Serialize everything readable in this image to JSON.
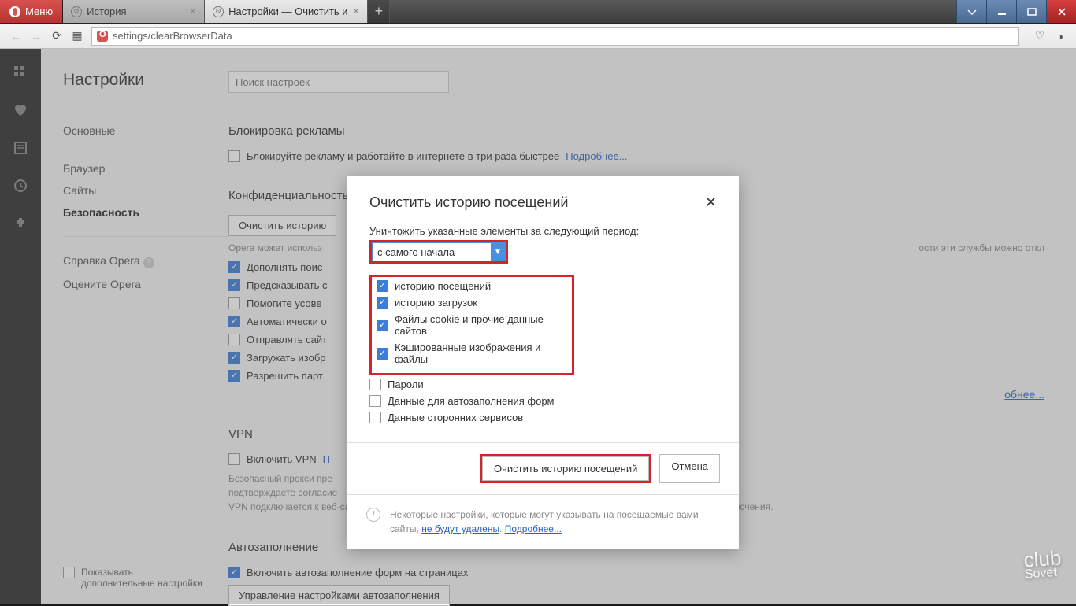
{
  "titlebar": {
    "menu": "Меню",
    "tabs": [
      {
        "label": "История",
        "active": false
      },
      {
        "label": "Настройки — Очистить и",
        "active": true
      }
    ]
  },
  "url": "settings/clearBrowserData",
  "sidebar": {
    "title": "Настройки",
    "items": [
      "Основные",
      "Браузер",
      "Сайты",
      "Безопасность"
    ],
    "active": 3,
    "help": "Справка Opera",
    "rate": "Оцените Opera"
  },
  "search_placeholder": "Поиск настроек",
  "sections": {
    "adblock": {
      "title": "Блокировка рекламы",
      "row": "Блокируйте рекламу и работайте в интернете в три раза быстрее",
      "more": "Подробнее..."
    },
    "privacy": {
      "title": "Конфиденциальность",
      "clear_btn": "Очистить историю",
      "desc_pre": "Opera может использ",
      "desc_post": "ости эти службы можно откл",
      "rows": [
        {
          "c": true,
          "t": "Дополнять поис"
        },
        {
          "c": true,
          "t": "Предсказывать с"
        },
        {
          "c": false,
          "t": "Помогите усове"
        },
        {
          "c": true,
          "t": "Автоматически о"
        },
        {
          "c": false,
          "t": "Отправлять сайт"
        },
        {
          "c": true,
          "t": "Загружать изобр"
        },
        {
          "c": true,
          "t": "Разрешить парт"
        }
      ],
      "more": "обнее..."
    },
    "vpn": {
      "title": "VPN",
      "row": "Включить VPN",
      "link": "П",
      "desc": "Безопасный прокси пре\nподтверждаете согласие\nVPN подключается к веб-сайтам через различные серверы по всему миру, что может отразиться на скорости подключения."
    },
    "autofill": {
      "title": "Автозаполнение",
      "row": "Включить автозаполнение форм на страницах",
      "btn": "Управление настройками автозаполнения"
    }
  },
  "show_adv": "Показывать дополнительные настройки",
  "modal": {
    "title": "Очистить историю посещений",
    "period_label": "Уничтожить указанные элементы за следующий период:",
    "period_value": "с самого начала",
    "items": [
      {
        "c": true,
        "t": "историю посещений",
        "hl": true
      },
      {
        "c": true,
        "t": "историю загрузок",
        "hl": true
      },
      {
        "c": true,
        "t": "Файлы cookie и прочие данные сайтов",
        "hl": true
      },
      {
        "c": true,
        "t": "Кэшированные изображения и файлы",
        "hl": true
      },
      {
        "c": false,
        "t": "Пароли",
        "hl": false
      },
      {
        "c": false,
        "t": "Данные для автозаполнения форм",
        "hl": false
      },
      {
        "c": false,
        "t": "Данные сторонних сервисов",
        "hl": false
      }
    ],
    "ok": "Очистить историю посещений",
    "cancel": "Отмена",
    "info": "Некоторые настройки, которые могут указывать на посещаемые вами сайты,",
    "info_link1": "не будут удалены",
    "info_link2": "Подробнее..."
  },
  "watermark": {
    "top": "club",
    "bottom": "Sovet"
  }
}
